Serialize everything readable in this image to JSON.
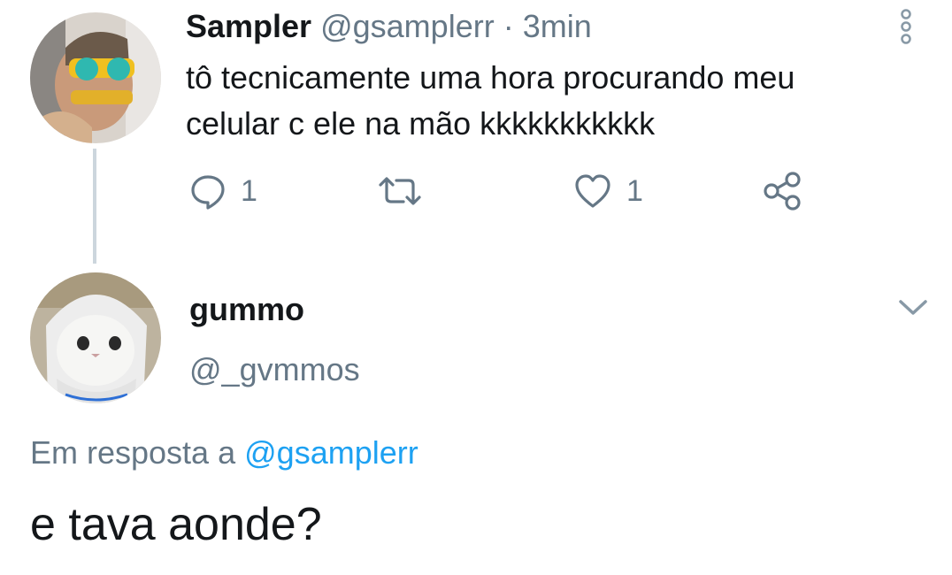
{
  "tweet": {
    "author_name": "Sampler",
    "author_handle": "@gsamplerr",
    "separator": "·",
    "time": "3min",
    "text_line1": "tô tecnicamente uma hora procurando meu",
    "text_line2": "celular c ele na mão kkkkkkkkkkk",
    "reply_count": "1",
    "like_count": "1"
  },
  "reply": {
    "author_name": "gummo",
    "author_handle": "@_gvmmos",
    "in_reply_prefix": "Em resposta a",
    "in_reply_mention": "@gsamplerr",
    "text": "e tava aonde?"
  },
  "icons": {
    "reply": "reply-bubble-icon",
    "retweet": "retweet-icon",
    "like": "heart-icon",
    "share": "share-icon",
    "more": "more-vertical-icon",
    "caret": "chevron-down-icon"
  },
  "colors": {
    "text": "#14171a",
    "muted": "#657786",
    "link": "#1da1f2",
    "thread_line": "#ccd6dd"
  }
}
